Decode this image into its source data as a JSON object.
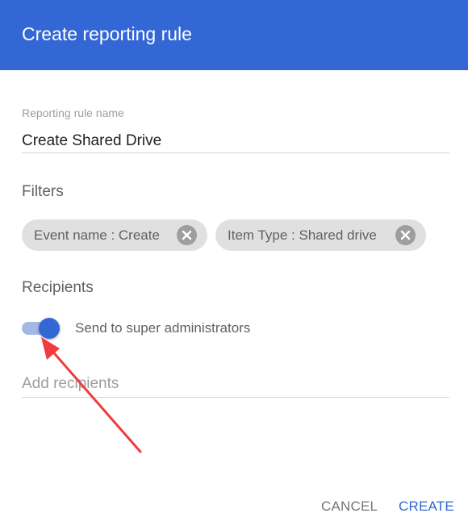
{
  "dialog": {
    "title": "Create reporting rule",
    "rule_name_label": "Reporting rule name",
    "rule_name_value": "Create Shared Drive",
    "filters_title": "Filters",
    "filters": [
      {
        "label": "Event name : Create"
      },
      {
        "label": "Item Type : Shared drive"
      }
    ],
    "recipients_title": "Recipients",
    "send_to_super_admins_label": "Send to super administrators",
    "send_to_super_admins_on": true,
    "add_recipients_placeholder": "Add recipients",
    "cancel_label": "CANCEL",
    "create_label": "CREATE"
  },
  "colors": {
    "header": "#3367d6",
    "accent": "#3367d6",
    "annotation_arrow": "#f03c3c"
  }
}
